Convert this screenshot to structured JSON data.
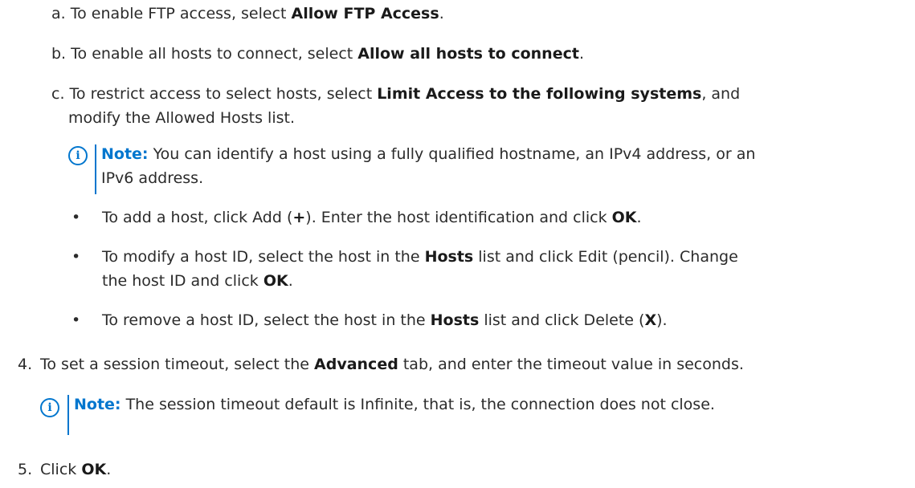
{
  "substeps": [
    {
      "marker": "a.",
      "t1": "To enable FTP access, select ",
      "b1": "Allow FTP Access",
      "t2": "."
    },
    {
      "marker": "b.",
      "t1": "To enable all hosts to connect, select ",
      "b1": "Allow all hosts to connect",
      "t2": "."
    },
    {
      "marker": "c.",
      "t1": "To restrict access to select hosts, select ",
      "b1": "Limit Access to the following systems",
      "t2": ", and",
      "cont": "modify the Allowed Hosts list."
    }
  ],
  "note1": {
    "icon": "i",
    "label": "Note:",
    "line1": " You can identify a host using a fully qualified hostname, an IPv4 address, or an",
    "line2": "IPv6 address."
  },
  "bullets": [
    {
      "glyph": "•",
      "t1": "To add a host, click Add (",
      "b1": "+",
      "t2": "). Enter the host identification and click ",
      "b2": "OK",
      "t3": "."
    },
    {
      "glyph": "•",
      "t1": "To modify a host ID, select the host in the ",
      "b1": "Hosts",
      "t2": " list and click Edit (pencil). Change",
      "cont1": "the host ID and click ",
      "cont_b": "OK",
      "cont2": "."
    },
    {
      "glyph": "•",
      "t1": "To remove a host ID, select the host in the ",
      "b1": "Hosts",
      "t2": " list and click Delete (",
      "b2": "X",
      "t3": ")."
    }
  ],
  "step4": {
    "num": "4.",
    "t1": "To set a session timeout, select the ",
    "b1": "Advanced",
    "t2": " tab, and enter the timeout value in seconds."
  },
  "note2": {
    "icon": "i",
    "label": "Note:",
    "text": " The session timeout default is Infinite, that is, the connection does not close."
  },
  "step5": {
    "num": "5.",
    "t1": "Click ",
    "b1": "OK",
    "t2": "."
  }
}
